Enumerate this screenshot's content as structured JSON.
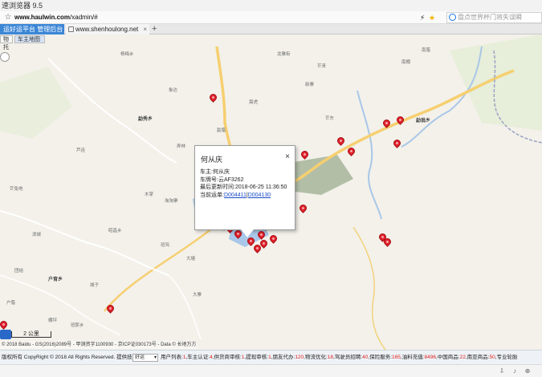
{
  "browser": {
    "title": "速浏览器 9.5",
    "url_host": "www.haulwin.com",
    "url_path": "/xadmin/#",
    "search_placeholder": "盘点世界杯门将失误瞬",
    "tabs": [
      {
        "label": "运好运平台 管理后台",
        "active": true
      },
      {
        "label": "www.shenhoulong.net",
        "active": false
      }
    ],
    "new_tab": "+"
  },
  "map": {
    "tabs": [
      "物托",
      "车主地图"
    ],
    "scale_label": "2 公里",
    "copyright": "© 2018 Baidu - GS(2016)2089号 - 甲测资字1100930 - 京ICP证030173号 - Data © 长地万方",
    "places": [
      {
        "name": "杨梅乡",
        "bold": false
      },
      {
        "name": "勐秀乡",
        "bold": true
      },
      {
        "name": "芒兔地",
        "bold": false
      },
      {
        "name": "户育乡",
        "bold": true
      },
      {
        "name": "班那乡",
        "bold": false
      },
      {
        "name": "昭昌乡",
        "bold": false
      },
      {
        "name": "芦连",
        "bold": false
      },
      {
        "name": "木掌",
        "bold": false
      },
      {
        "name": "勐腊",
        "bold": false
      },
      {
        "name": "大塘",
        "bold": false
      },
      {
        "name": "泼城",
        "bold": false
      },
      {
        "name": "龙雅街",
        "bold": false
      },
      {
        "name": "新寨",
        "bold": false
      },
      {
        "name": "芒东",
        "bold": false
      },
      {
        "name": "象达",
        "bold": false
      },
      {
        "name": "嵩虎",
        "bold": false
      },
      {
        "name": "弄林",
        "bold": false
      },
      {
        "name": "班骂",
        "bold": false
      },
      {
        "name": "大寨",
        "bold": false
      },
      {
        "name": "芒来",
        "bold": false
      },
      {
        "name": "南棚",
        "bold": false
      },
      {
        "name": "淘淘寨",
        "bold": false
      },
      {
        "name": "南腊",
        "bold": false
      },
      {
        "name": "勐翁乡",
        "bold": true
      },
      {
        "name": "户腊",
        "bold": false
      },
      {
        "name": "团结",
        "bold": false
      },
      {
        "name": "城子",
        "bold": false
      },
      {
        "name": "棚坪",
        "bold": false
      }
    ]
  },
  "info_window": {
    "title": "何从庆",
    "close": "×",
    "owner_label": "车主:",
    "owner_value": "何从庆",
    "plate_label": "车牌号:",
    "plate_value": "云AF3262",
    "updated_label": "最后更新时间:",
    "updated_value": "2018-06-25 11:36:50",
    "orders_label": "当前运单:",
    "order_1": "D004411",
    "order_sep": "|",
    "order_2": "D004130"
  },
  "status_bar": {
    "copyright": "版权所有 CopyRight © 2018 All Rights Reserved. 提供技术支持",
    "select_value": "好运",
    "stats": [
      {
        "label": "用户列表:",
        "value": "1"
      },
      {
        "label": "车主认证:",
        "value": "4"
      },
      {
        "label": "供货商审核:",
        "value": "1"
      },
      {
        "label": "提现审核:",
        "value": "1"
      },
      {
        "label": "朋友代办:",
        "value": "120"
      },
      {
        "label": "物流优化:",
        "value": "18"
      },
      {
        "label": "驾驶员招聘:",
        "value": "40"
      },
      {
        "label": "保险服务:",
        "value": "165"
      },
      {
        "label": "油料充值:",
        "value": "8496"
      },
      {
        "label": "中国商品:",
        "value": "22"
      },
      {
        "label": "南亚商品:",
        "value": "50"
      },
      {
        "label": "专业轮胎",
        "value": ""
      }
    ]
  },
  "colors": {
    "accent": "#3b86d6",
    "pin": "#e0202a",
    "road_major": "#f6cf70",
    "water": "#a9c7e8",
    "link": "#1b4cc7"
  }
}
